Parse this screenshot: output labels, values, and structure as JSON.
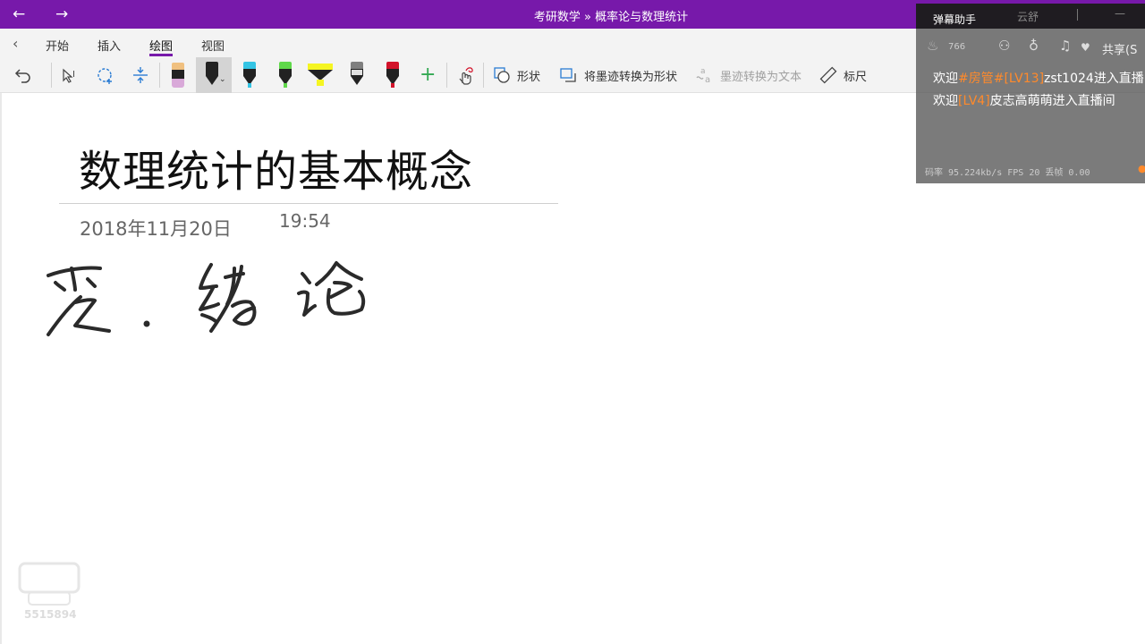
{
  "titlebar": {
    "back": "←",
    "forward": "→",
    "title": "考研数学 » 概率论与数理统计"
  },
  "ribbon": {
    "collapse": "‹",
    "tabs": [
      "开始",
      "插入",
      "绘图",
      "视图"
    ],
    "active_tab": "绘图",
    "accent_color": "#7719aa",
    "tools": {
      "shapes": "形状",
      "ink_to_shape": "将墨迹转换为形状",
      "ink_to_text": "墨迹转换为文本",
      "ruler": "标尺",
      "add_pen": "+"
    },
    "pens": [
      {
        "name": "eraser-pen",
        "color": "#d9a9d9"
      },
      {
        "name": "black-pen",
        "color": "#222222",
        "selected": true
      },
      {
        "name": "cyan-pen",
        "color": "#34c4e4"
      },
      {
        "name": "green-pen",
        "color": "#5fd84a"
      },
      {
        "name": "yellow-highlighter",
        "color": "#f5f522"
      },
      {
        "name": "gray-pencil",
        "color": "#7f7f7f"
      },
      {
        "name": "red-pen",
        "color": "#d2132a"
      }
    ]
  },
  "page": {
    "title": "数理统计的基本概念",
    "date": "2018年11月20日",
    "time": "19:54"
  },
  "danmu": {
    "title": "弹幕助手",
    "user": "云舒",
    "minimize": "—",
    "fire_count": "766",
    "share": "共享(S",
    "messages": [
      {
        "prefix": "欢迎",
        "tag": "#房管#[LV13]",
        "user": "zst1024",
        "suffix": "进入直播间"
      },
      {
        "prefix": "欢迎",
        "tag": "[LV4]",
        "user": "皮志高萌萌",
        "suffix": "进入直播间"
      }
    ],
    "footer": "码率 95.224kb/s FPS 20 丢帧 0.00"
  },
  "watermark": {
    "id": "5515894"
  }
}
